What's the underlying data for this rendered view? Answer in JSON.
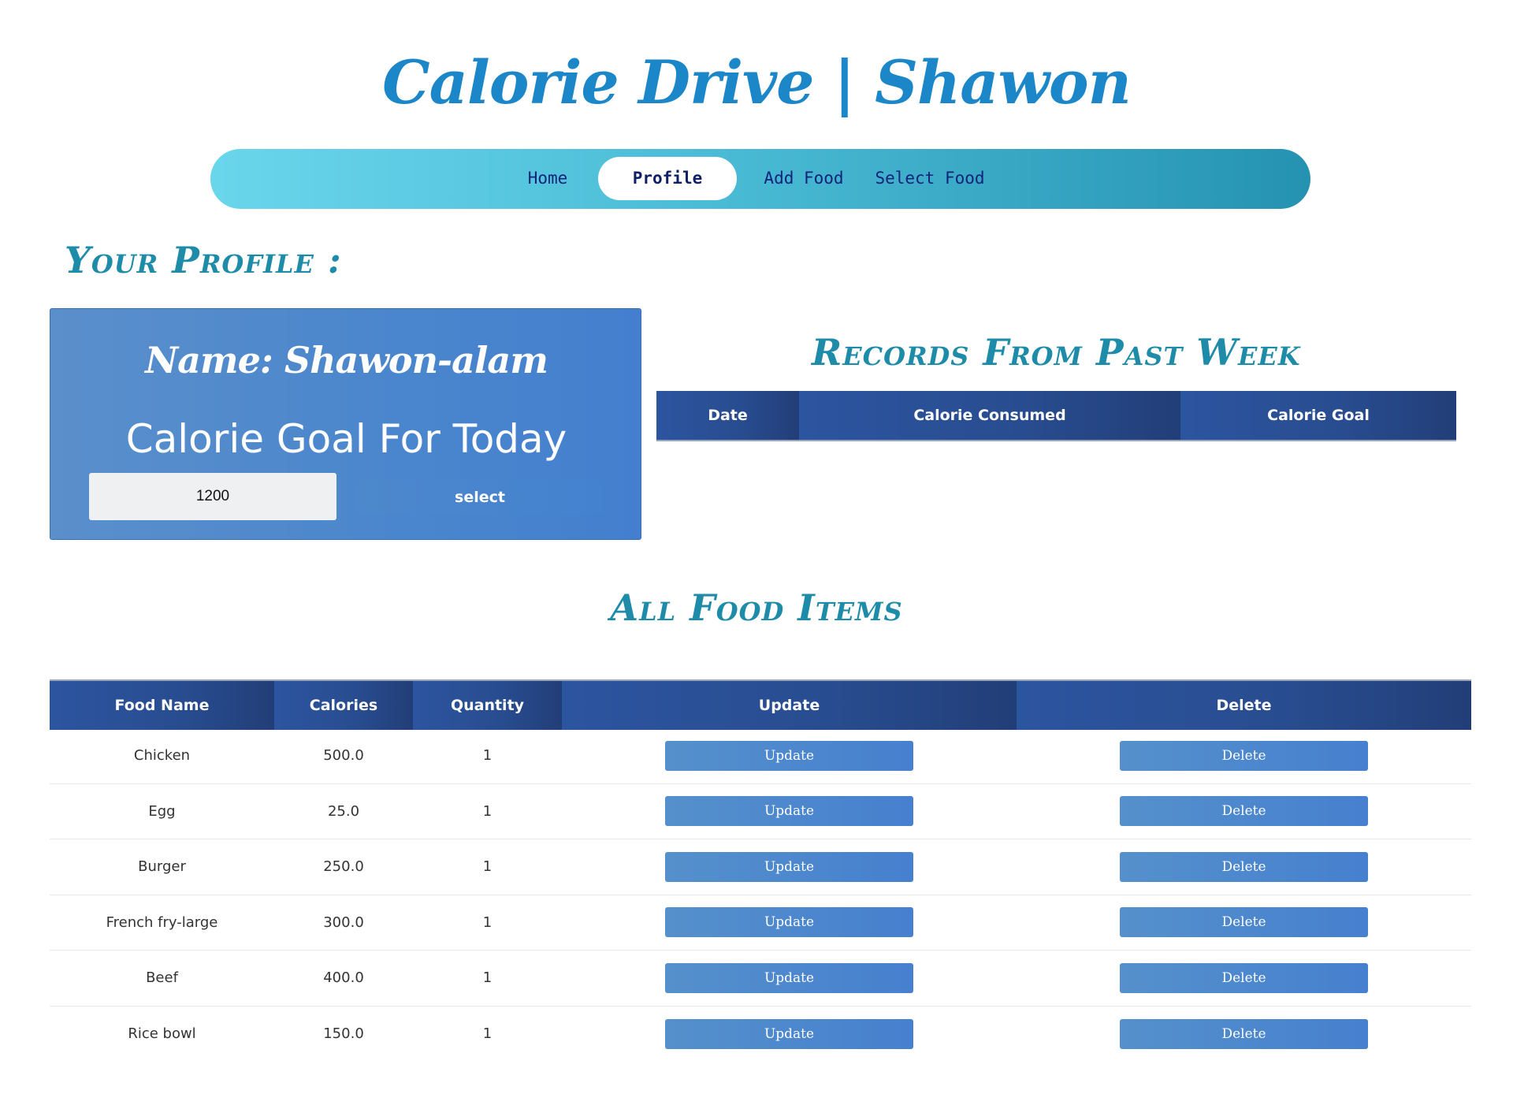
{
  "header": {
    "title": "Calorie Drive | Shawon"
  },
  "nav": {
    "items": [
      {
        "label": "Home",
        "active": false
      },
      {
        "label": "Profile",
        "active": true
      },
      {
        "label": "Add Food",
        "active": false
      },
      {
        "label": "Select Food",
        "active": false
      }
    ]
  },
  "profile": {
    "heading": "Your Profile :",
    "name": "Name: Shawon-alam",
    "goal_label": "Calorie Goal For Today",
    "goal_value": "1200",
    "select_label": "select"
  },
  "records": {
    "heading": "Records From Past Week",
    "columns": [
      "Date",
      "Calorie Consumed",
      "Calorie Goal"
    ]
  },
  "food": {
    "heading": "All Food Items",
    "columns": [
      "Food Name",
      "Calories",
      "Quantity",
      "Update",
      "Delete"
    ],
    "update_label": "Update",
    "delete_label": "Delete",
    "rows": [
      {
        "name": "Chicken",
        "calories": "500.0",
        "quantity": "1"
      },
      {
        "name": "Egg",
        "calories": "25.0",
        "quantity": "1"
      },
      {
        "name": "Burger",
        "calories": "250.0",
        "quantity": "1"
      },
      {
        "name": "French fry-large",
        "calories": "300.0",
        "quantity": "1"
      },
      {
        "name": "Beef",
        "calories": "400.0",
        "quantity": "1"
      },
      {
        "name": "Rice bowl",
        "calories": "150.0",
        "quantity": "1"
      }
    ]
  },
  "colors": {
    "title": "#1b86c8",
    "heading": "#1e8ca8",
    "nav_start": "#6ad6ec",
    "nav_end": "#2592b2",
    "table_header": "#284c8f",
    "button": "#4a86cd"
  }
}
